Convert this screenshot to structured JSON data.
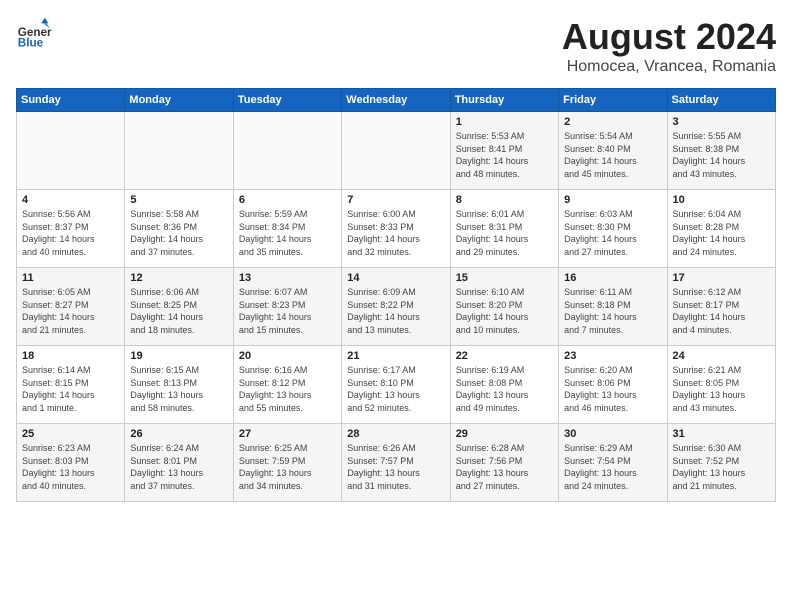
{
  "header": {
    "logo_text_top": "General",
    "logo_text_bottom": "Blue",
    "month_title": "August 2024",
    "location": "Homocea, Vrancea, Romania"
  },
  "weekdays": [
    "Sunday",
    "Monday",
    "Tuesday",
    "Wednesday",
    "Thursday",
    "Friday",
    "Saturday"
  ],
  "weeks": [
    [
      {
        "day": "",
        "info": ""
      },
      {
        "day": "",
        "info": ""
      },
      {
        "day": "",
        "info": ""
      },
      {
        "day": "",
        "info": ""
      },
      {
        "day": "1",
        "info": "Sunrise: 5:53 AM\nSunset: 8:41 PM\nDaylight: 14 hours\nand 48 minutes."
      },
      {
        "day": "2",
        "info": "Sunrise: 5:54 AM\nSunset: 8:40 PM\nDaylight: 14 hours\nand 45 minutes."
      },
      {
        "day": "3",
        "info": "Sunrise: 5:55 AM\nSunset: 8:38 PM\nDaylight: 14 hours\nand 43 minutes."
      }
    ],
    [
      {
        "day": "4",
        "info": "Sunrise: 5:56 AM\nSunset: 8:37 PM\nDaylight: 14 hours\nand 40 minutes."
      },
      {
        "day": "5",
        "info": "Sunrise: 5:58 AM\nSunset: 8:36 PM\nDaylight: 14 hours\nand 37 minutes."
      },
      {
        "day": "6",
        "info": "Sunrise: 5:59 AM\nSunset: 8:34 PM\nDaylight: 14 hours\nand 35 minutes."
      },
      {
        "day": "7",
        "info": "Sunrise: 6:00 AM\nSunset: 8:33 PM\nDaylight: 14 hours\nand 32 minutes."
      },
      {
        "day": "8",
        "info": "Sunrise: 6:01 AM\nSunset: 8:31 PM\nDaylight: 14 hours\nand 29 minutes."
      },
      {
        "day": "9",
        "info": "Sunrise: 6:03 AM\nSunset: 8:30 PM\nDaylight: 14 hours\nand 27 minutes."
      },
      {
        "day": "10",
        "info": "Sunrise: 6:04 AM\nSunset: 8:28 PM\nDaylight: 14 hours\nand 24 minutes."
      }
    ],
    [
      {
        "day": "11",
        "info": "Sunrise: 6:05 AM\nSunset: 8:27 PM\nDaylight: 14 hours\nand 21 minutes."
      },
      {
        "day": "12",
        "info": "Sunrise: 6:06 AM\nSunset: 8:25 PM\nDaylight: 14 hours\nand 18 minutes."
      },
      {
        "day": "13",
        "info": "Sunrise: 6:07 AM\nSunset: 8:23 PM\nDaylight: 14 hours\nand 15 minutes."
      },
      {
        "day": "14",
        "info": "Sunrise: 6:09 AM\nSunset: 8:22 PM\nDaylight: 14 hours\nand 13 minutes."
      },
      {
        "day": "15",
        "info": "Sunrise: 6:10 AM\nSunset: 8:20 PM\nDaylight: 14 hours\nand 10 minutes."
      },
      {
        "day": "16",
        "info": "Sunrise: 6:11 AM\nSunset: 8:18 PM\nDaylight: 14 hours\nand 7 minutes."
      },
      {
        "day": "17",
        "info": "Sunrise: 6:12 AM\nSunset: 8:17 PM\nDaylight: 14 hours\nand 4 minutes."
      }
    ],
    [
      {
        "day": "18",
        "info": "Sunrise: 6:14 AM\nSunset: 8:15 PM\nDaylight: 14 hours\nand 1 minute."
      },
      {
        "day": "19",
        "info": "Sunrise: 6:15 AM\nSunset: 8:13 PM\nDaylight: 13 hours\nand 58 minutes."
      },
      {
        "day": "20",
        "info": "Sunrise: 6:16 AM\nSunset: 8:12 PM\nDaylight: 13 hours\nand 55 minutes."
      },
      {
        "day": "21",
        "info": "Sunrise: 6:17 AM\nSunset: 8:10 PM\nDaylight: 13 hours\nand 52 minutes."
      },
      {
        "day": "22",
        "info": "Sunrise: 6:19 AM\nSunset: 8:08 PM\nDaylight: 13 hours\nand 49 minutes."
      },
      {
        "day": "23",
        "info": "Sunrise: 6:20 AM\nSunset: 8:06 PM\nDaylight: 13 hours\nand 46 minutes."
      },
      {
        "day": "24",
        "info": "Sunrise: 6:21 AM\nSunset: 8:05 PM\nDaylight: 13 hours\nand 43 minutes."
      }
    ],
    [
      {
        "day": "25",
        "info": "Sunrise: 6:23 AM\nSunset: 8:03 PM\nDaylight: 13 hours\nand 40 minutes."
      },
      {
        "day": "26",
        "info": "Sunrise: 6:24 AM\nSunset: 8:01 PM\nDaylight: 13 hours\nand 37 minutes."
      },
      {
        "day": "27",
        "info": "Sunrise: 6:25 AM\nSunset: 7:59 PM\nDaylight: 13 hours\nand 34 minutes."
      },
      {
        "day": "28",
        "info": "Sunrise: 6:26 AM\nSunset: 7:57 PM\nDaylight: 13 hours\nand 31 minutes."
      },
      {
        "day": "29",
        "info": "Sunrise: 6:28 AM\nSunset: 7:56 PM\nDaylight: 13 hours\nand 27 minutes."
      },
      {
        "day": "30",
        "info": "Sunrise: 6:29 AM\nSunset: 7:54 PM\nDaylight: 13 hours\nand 24 minutes."
      },
      {
        "day": "31",
        "info": "Sunrise: 6:30 AM\nSunset: 7:52 PM\nDaylight: 13 hours\nand 21 minutes."
      }
    ]
  ]
}
